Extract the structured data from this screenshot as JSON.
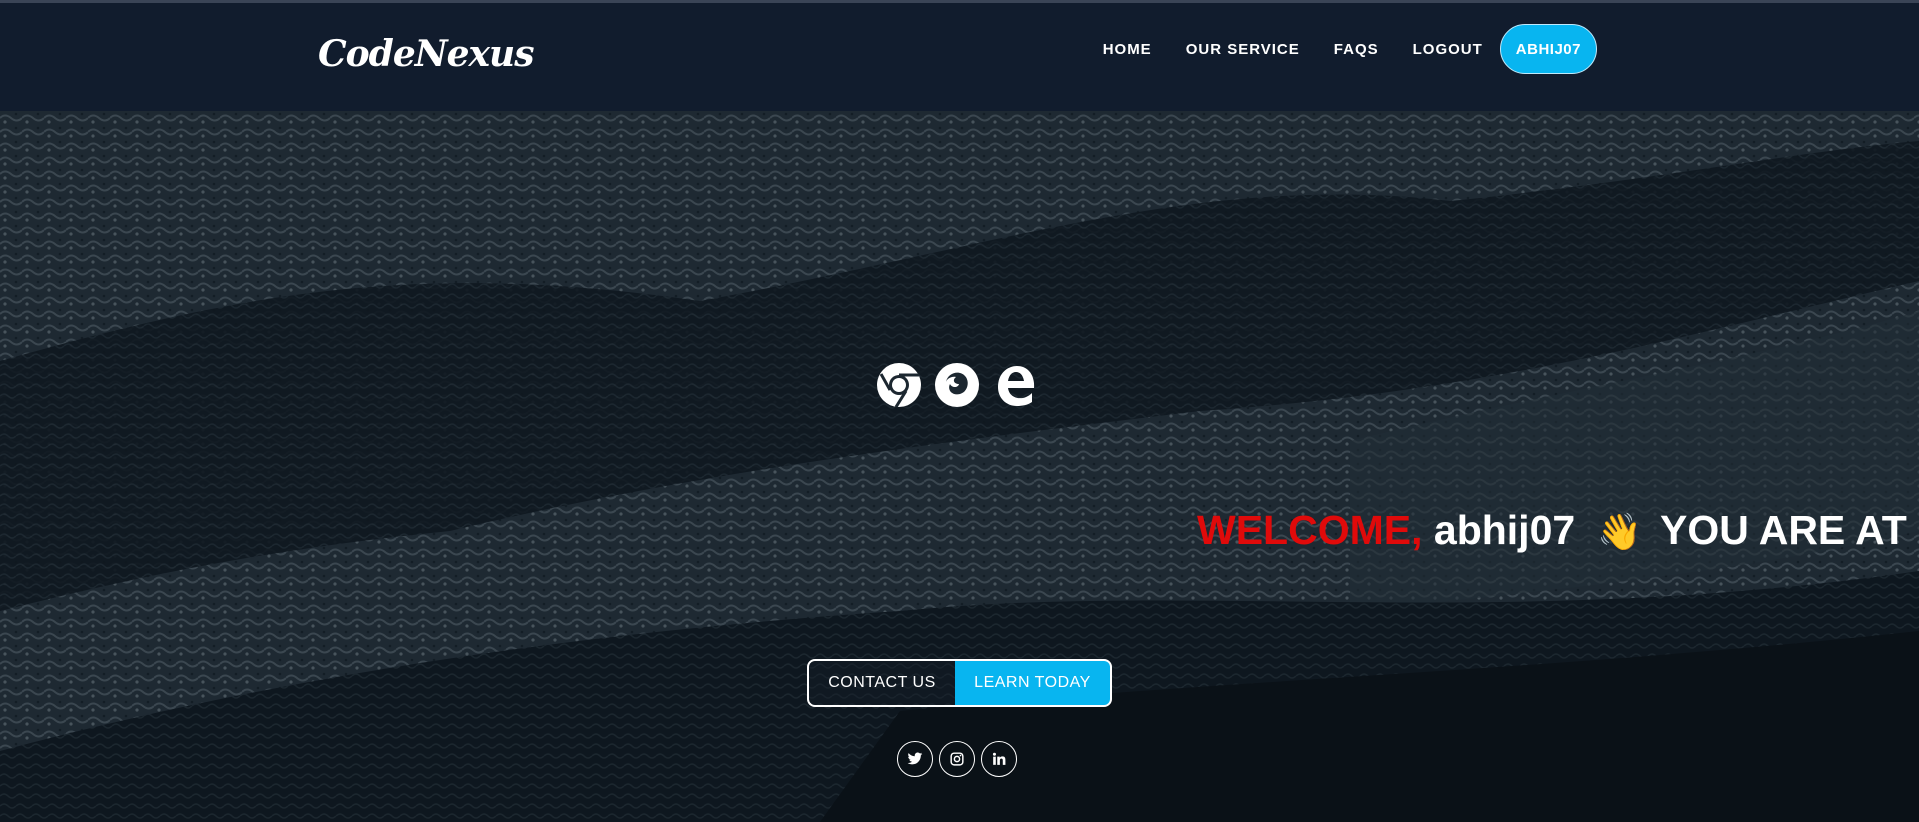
{
  "brand": {
    "logo_text": "CodeNexus"
  },
  "nav": {
    "items": [
      {
        "label": "HOME"
      },
      {
        "label": "OUR SERVICE"
      },
      {
        "label": "FAQS"
      },
      {
        "label": "LOGOUT"
      }
    ],
    "user_button": "ABHIJ07"
  },
  "hero": {
    "browser_icons": [
      "chrome-icon",
      "firefox-icon",
      "edge-icon"
    ],
    "welcome": {
      "prefix": "WELCOME,",
      "username": "abhij07",
      "emoji": "👋",
      "suffix": "YOU ARE AT F"
    },
    "buttons": {
      "contact": "CONTACT US",
      "learn": "LEARN TODAY"
    },
    "social": [
      "twitter-icon",
      "instagram-icon",
      "linkedin-icon"
    ]
  },
  "colors": {
    "navbar": "#111c2d",
    "accent": "#08b5f0",
    "welcome_red": "#e00a0a"
  }
}
